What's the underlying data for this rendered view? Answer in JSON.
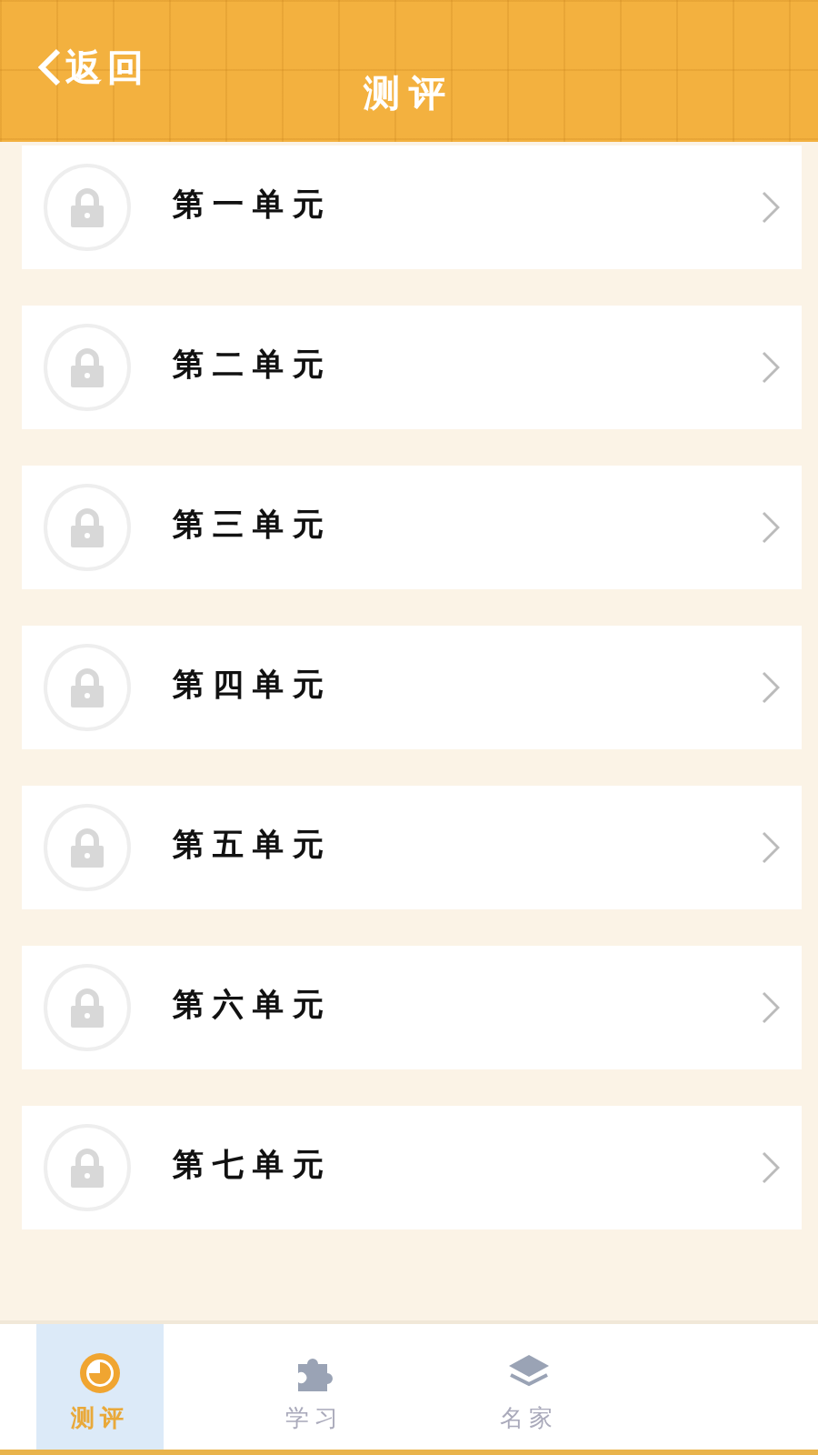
{
  "header": {
    "back": "返回",
    "title": "测评"
  },
  "units": [
    {
      "title": "第一单元",
      "locked": true
    },
    {
      "title": "第二单元",
      "locked": true
    },
    {
      "title": "第三单元",
      "locked": true
    },
    {
      "title": "第四单元",
      "locked": true
    },
    {
      "title": "第五单元",
      "locked": true
    },
    {
      "title": "第六单元",
      "locked": true
    },
    {
      "title": "第七单元",
      "locked": true
    }
  ],
  "tabs": [
    {
      "label": "测评",
      "kind": "evaluate",
      "selected": true
    },
    {
      "label": "学习",
      "kind": "puzzle",
      "selected": false
    },
    {
      "label": "名家",
      "kind": "layers",
      "selected": false
    }
  ]
}
